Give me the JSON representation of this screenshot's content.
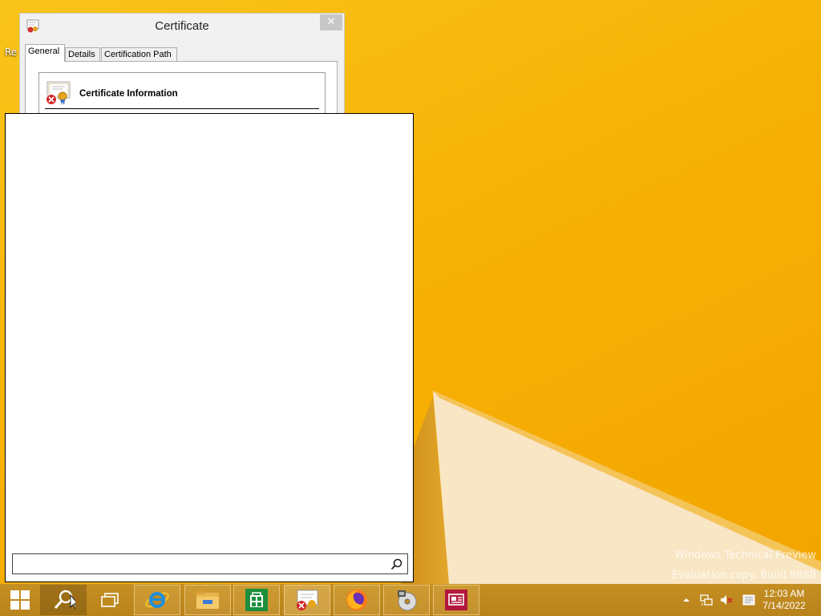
{
  "desktop": {
    "icon_label": "Re",
    "watermark_line1": "Windows Technical Preview",
    "watermark_line2": "Evaluation copy. Build 9888"
  },
  "certificate_dialog": {
    "title": "Certificate",
    "close_glyph": "✕",
    "tabs": [
      {
        "label": "General",
        "active": true
      },
      {
        "label": "Details",
        "active": false
      },
      {
        "label": "Certification Path",
        "active": false
      }
    ],
    "info_title": "Certificate Information"
  },
  "search": {
    "input_value": "",
    "input_placeholder": ""
  },
  "taskbar": {
    "items": [
      {
        "name": "start-button",
        "icon": "windows-logo-icon"
      },
      {
        "name": "search-button",
        "icon": "search-icon"
      },
      {
        "name": "task-view-button",
        "icon": "task-view-icon"
      },
      {
        "name": "internet-explorer",
        "icon": "internet-explorer-icon"
      },
      {
        "name": "file-explorer",
        "icon": "folder-icon"
      },
      {
        "name": "store",
        "icon": "store-icon"
      },
      {
        "name": "certificate-window",
        "icon": "certificate-icon"
      },
      {
        "name": "firefox",
        "icon": "firefox-icon"
      },
      {
        "name": "media-app",
        "icon": "media-disc-icon"
      },
      {
        "name": "news-app",
        "icon": "news-icon"
      }
    ],
    "tray": {
      "time": "12:03 AM",
      "date": "7/14/2022",
      "icons": [
        "tray-overflow-icon",
        "network-icon",
        "volume-muted-icon",
        "action-center-icon"
      ]
    }
  },
  "colors": {
    "desktop_yellow": "#f7b206",
    "taskbar": "#c08a1f",
    "close_button": "#c7c7c7"
  }
}
